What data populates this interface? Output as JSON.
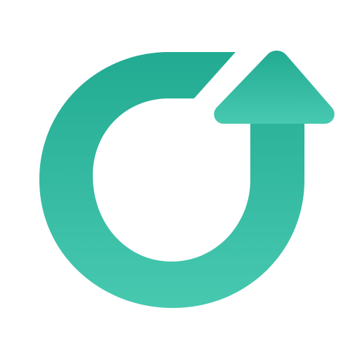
{
  "icon": {
    "name": "circular-arrow-up-icon",
    "background": "#ffffff",
    "gradient": {
      "top": "#22ab92",
      "bottom": "#47c9b0"
    }
  }
}
